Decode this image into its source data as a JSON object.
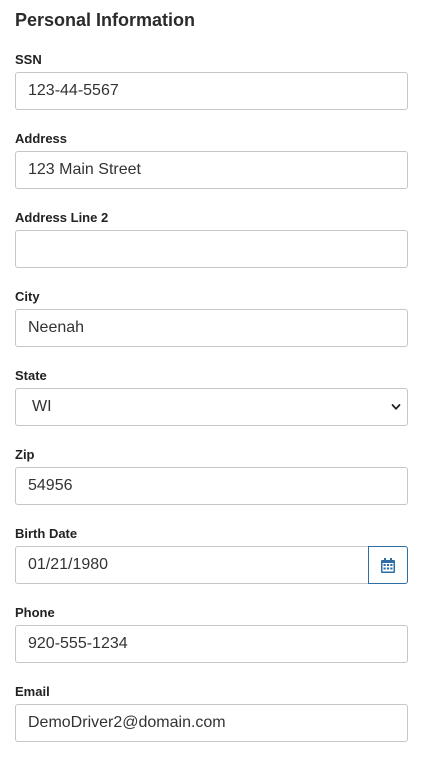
{
  "section_title": "Personal Information",
  "fields": {
    "ssn": {
      "label": "SSN",
      "value": "123-44-5567"
    },
    "address": {
      "label": "Address",
      "value": "123 Main Street"
    },
    "address2": {
      "label": "Address Line 2",
      "value": ""
    },
    "city": {
      "label": "City",
      "value": "Neenah"
    },
    "state": {
      "label": "State",
      "value": "WI"
    },
    "zip": {
      "label": "Zip",
      "value": "54956"
    },
    "birth_date": {
      "label": "Birth Date",
      "value": "01/21/1980"
    },
    "phone": {
      "label": "Phone",
      "value": "920-555-1234"
    },
    "email": {
      "label": "Email",
      "value": "DemoDriver2@domain.com"
    }
  },
  "icons": {
    "calendar": "calendar-icon",
    "chevron": "chevron-down-icon"
  },
  "colors": {
    "accent": "#2d6da3",
    "border": "#c6c6c6",
    "text": "#333333"
  }
}
